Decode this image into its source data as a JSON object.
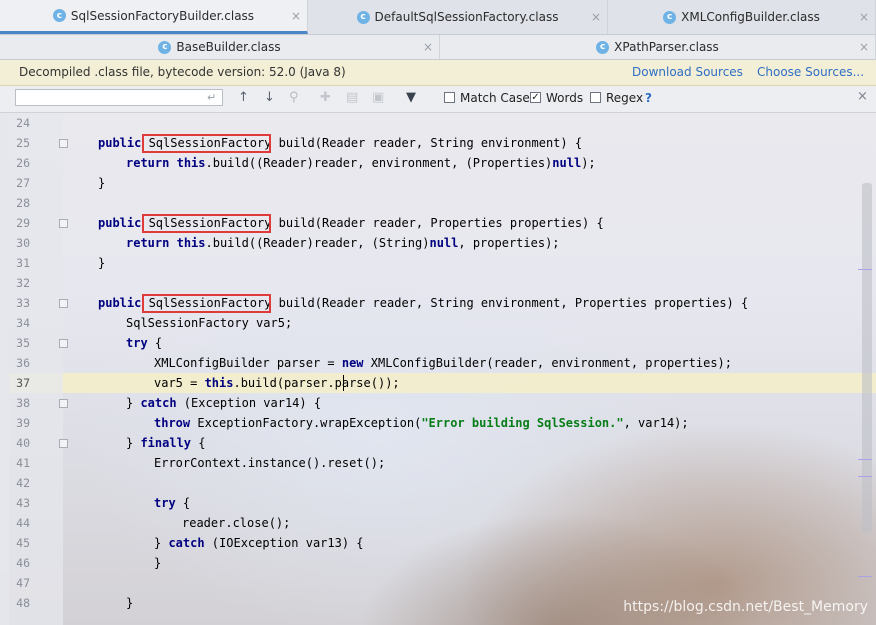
{
  "tabs_row1": [
    {
      "label": "SqlSessionFactoryBuilder.class",
      "active": true
    },
    {
      "label": "DefaultSqlSessionFactory.class",
      "active": false
    },
    {
      "label": "XMLConfigBuilder.class",
      "active": false
    }
  ],
  "tabs_row2": [
    {
      "label": "BaseBuilder.class"
    },
    {
      "label": "XPathParser.class"
    }
  ],
  "tab_close_glyph": "×",
  "notice": {
    "text": "Decompiled .class file, bytecode version: 52.0 (Java 8)",
    "download_sources": "Download Sources",
    "choose_sources": "Choose Sources..."
  },
  "search": {
    "query": "",
    "options": {
      "match_case": {
        "label": "Match Case",
        "checked": false
      },
      "words": {
        "label": "Words",
        "checked": true
      },
      "regex": {
        "label": "Regex",
        "checked": false
      }
    },
    "help": "?"
  },
  "editor": {
    "line_numbers": [
      "24",
      "25",
      "26",
      "27",
      "28",
      "29",
      "30",
      "31",
      "32",
      "33",
      "34",
      "35",
      "36",
      "37",
      "38",
      "39",
      "40",
      "41",
      "42",
      "43",
      "44",
      "45",
      "46",
      "47",
      "48"
    ],
    "current_line": "37",
    "highlight_term": "SqlSessionFactory",
    "watermark": "https://blog.csdn.net/Best_Memory"
  },
  "colors": {
    "keyword": "#000080",
    "string": "#067d17",
    "highlight_box": "#e03b3b",
    "link": "#2e6ec6"
  }
}
